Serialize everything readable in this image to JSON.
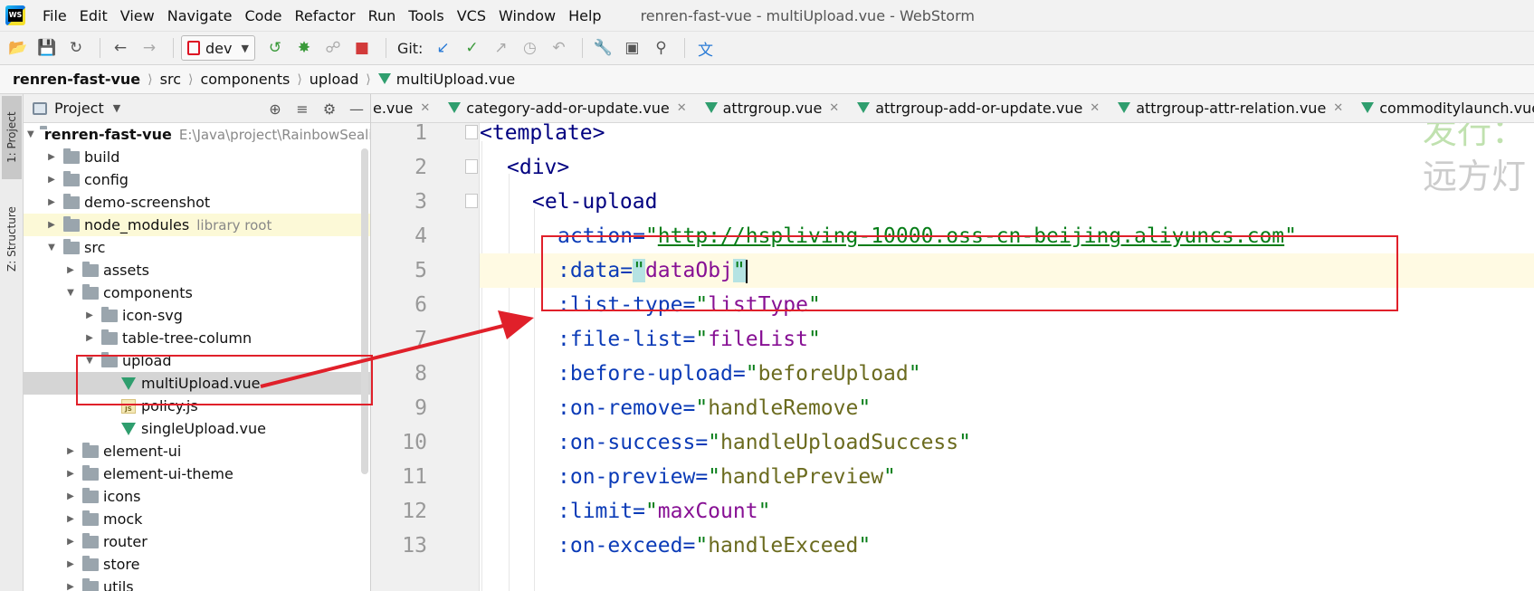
{
  "window": {
    "title": "renren-fast-vue - multiUpload.vue - WebStorm"
  },
  "menu": {
    "items": [
      "File",
      "Edit",
      "View",
      "Navigate",
      "Code",
      "Refactor",
      "Run",
      "Tools",
      "VCS",
      "Window",
      "Help"
    ]
  },
  "toolbar": {
    "run_config": "dev",
    "git_label": "Git:"
  },
  "breadcrumb": {
    "items": [
      "renren-fast-vue",
      "src",
      "components",
      "upload",
      "multiUpload.vue"
    ]
  },
  "side_strip": {
    "project_tab": "1: Project",
    "structure_tab": "Z: Structure"
  },
  "project_panel": {
    "title": "Project",
    "root_name": "renren-fast-vue",
    "root_path": "E:\\Java\\project\\RainbowSeali",
    "library_root_label": "library root",
    "rows": [
      {
        "label": "build"
      },
      {
        "label": "config"
      },
      {
        "label": "demo-screenshot"
      },
      {
        "label": "node_modules"
      },
      {
        "label": "src"
      },
      {
        "label": "assets"
      },
      {
        "label": "components"
      },
      {
        "label": "icon-svg"
      },
      {
        "label": "table-tree-column"
      },
      {
        "label": "upload"
      },
      {
        "label": "multiUpload.vue"
      },
      {
        "label": "policy.js"
      },
      {
        "label": "singleUpload.vue"
      },
      {
        "label": "element-ui"
      },
      {
        "label": "element-ui-theme"
      },
      {
        "label": "icons"
      },
      {
        "label": "mock"
      },
      {
        "label": "router"
      },
      {
        "label": "store"
      },
      {
        "label": "utils"
      }
    ]
  },
  "editor_tabs": [
    {
      "label": "e.vue"
    },
    {
      "label": "category-add-or-update.vue"
    },
    {
      "label": "attrgroup.vue"
    },
    {
      "label": "attrgroup-add-or-update.vue"
    },
    {
      "label": "attrgroup-attr-relation.vue"
    },
    {
      "label": "commoditylaunch.vue"
    }
  ],
  "code": {
    "line_numbers": [
      "1",
      "2",
      "3",
      "4",
      "5",
      "6",
      "7",
      "8",
      "9",
      "10",
      "11",
      "12",
      "13"
    ],
    "l1_tag": "<template>",
    "l2_tag": "<div>",
    "l3_tag": "<el-upload",
    "l4_attr": "action=",
    "l4_url": "http://hspliving-10000.oss-cn-beijing.aliyuncs.com",
    "l5_attr": ":data=",
    "l5_val": "dataObj",
    "l6_attr": ":list-type=",
    "l6_val": "listType",
    "l7_attr": ":file-list=",
    "l7_val": "fileList",
    "l8_attr": ":before-upload=",
    "l8_val": "beforeUpload",
    "l9_attr": ":on-remove=",
    "l9_val": "handleRemove",
    "l10_attr": ":on-success=",
    "l10_val": "handleUploadSuccess",
    "l11_attr": ":on-preview=",
    "l11_val": "handlePreview",
    "l12_attr": ":limit=",
    "l12_val": "maxCount",
    "l13_attr": ":on-exceed=",
    "l13_val": "handleExceed"
  },
  "watermark": {
    "line1": "发行：",
    "line2": "远方灯"
  },
  "colors": {
    "annotation_red": "#e0202a",
    "vue_green": "#2f9e6e",
    "tag_blue": "#000080",
    "attr_blue": "#0b3bb7",
    "string_green": "#067d17",
    "value_purple": "#871094"
  }
}
